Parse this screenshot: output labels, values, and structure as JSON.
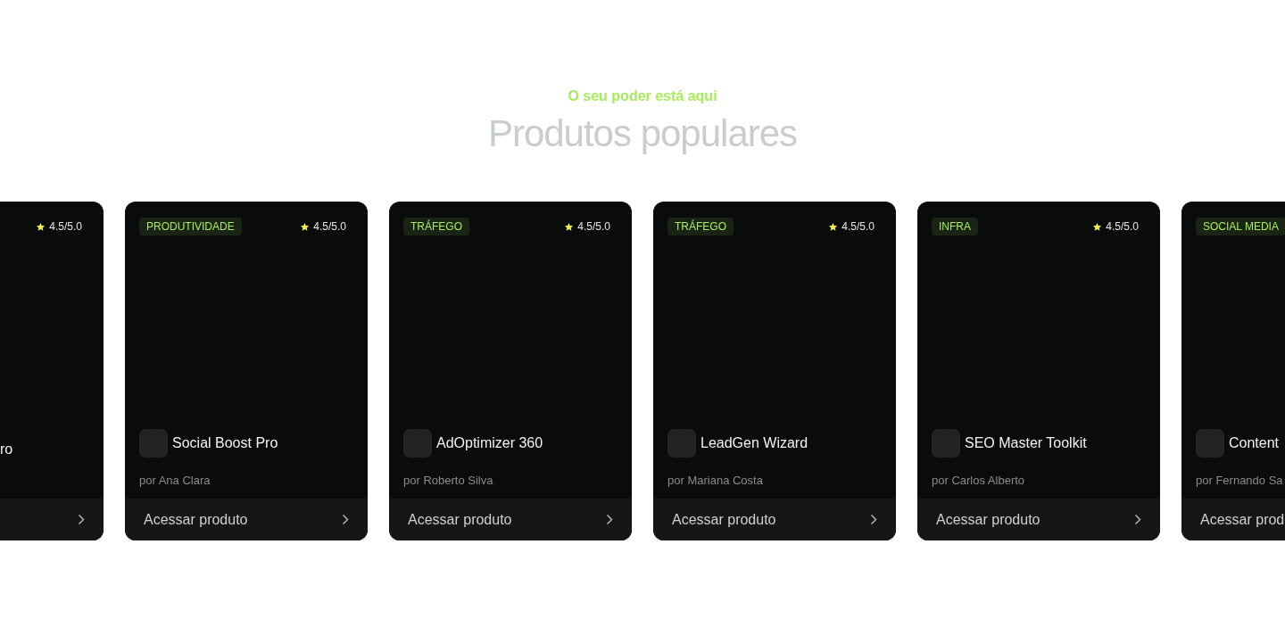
{
  "eyebrow": "O seu poder está aqui",
  "title": "Produtos populares",
  "products": [
    {
      "kind": "partial_left",
      "rating": "4.5/5.0",
      "name": "ro"
    },
    {
      "kind": "full",
      "tag": "PRODUTIVIDADE",
      "rating": "4.5/5.0",
      "name": "Social Boost Pro",
      "author": "por Ana Clara",
      "action": "Acessar produto"
    },
    {
      "kind": "full",
      "tag": "TRÁFEGO",
      "rating": "4.5/5.0",
      "name": "AdOptimizer 360",
      "author": "por Roberto Silva",
      "action": "Acessar produto"
    },
    {
      "kind": "full",
      "tag": "TRÁFEGO",
      "rating": "4.5/5.0",
      "name": "LeadGen Wizard",
      "author": "por Mariana Costa",
      "action": "Acessar produto"
    },
    {
      "kind": "full",
      "tag": "INFRA",
      "rating": "4.5/5.0",
      "name": "SEO Master Toolkit",
      "author": "por Carlos Alberto",
      "action": "Acessar produto"
    },
    {
      "kind": "partial_right",
      "tag": "SOCIAL MEDIA",
      "name": "Content",
      "author": "por Fernando Sa",
      "action": "Acessar prod"
    }
  ]
}
